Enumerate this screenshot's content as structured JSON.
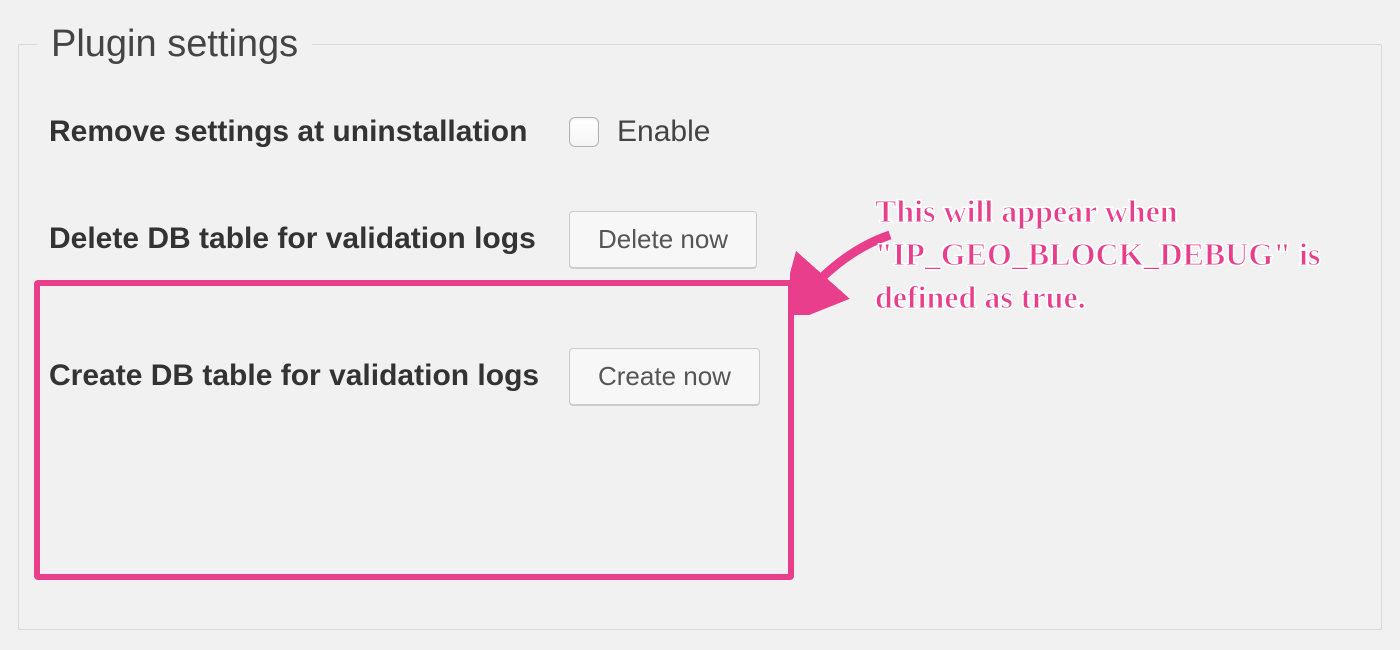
{
  "fieldset": {
    "legend": "Plugin settings"
  },
  "remove_settings": {
    "label": "Remove settings at uninstallation",
    "checkbox_text": "Enable"
  },
  "delete_db": {
    "label": "Delete DB table for validation logs",
    "button_label": "Delete now"
  },
  "create_db": {
    "label": "Create DB table for validation logs",
    "button_label": "Create now"
  },
  "callout": {
    "text": "This will appear when \"IP_GEO_BLOCK_DEBUG\" is defined as true."
  },
  "colors": {
    "highlight": "#e83e8c"
  }
}
